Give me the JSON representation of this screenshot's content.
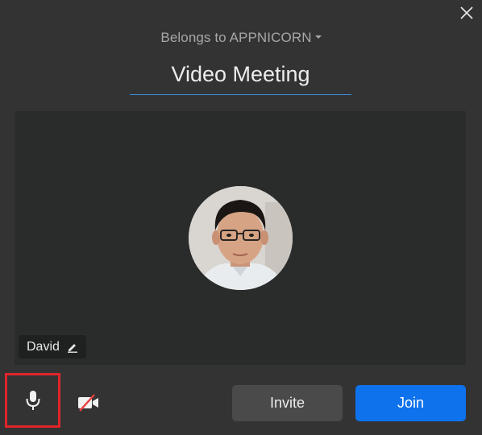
{
  "dialog": {
    "close_icon": "close-icon",
    "owner_label": "Belongs to APPNICORN",
    "owner_dropdown_icon": "caret-down-icon"
  },
  "meeting": {
    "title_value": "Video Meeting"
  },
  "preview": {
    "participant_name": "David",
    "edit_icon": "pencil-icon",
    "avatar": "user-avatar-photo"
  },
  "controls": {
    "mic_icon": "microphone-icon",
    "video_icon": "video-off-icon",
    "invite_label": "Invite",
    "join_label": "Join"
  },
  "colors": {
    "background": "#333333",
    "preview_background": "#2a2c2c",
    "accent_blue": "#0e72ed",
    "highlight_red": "#e0242b",
    "video_off_red": "#e8403f"
  }
}
